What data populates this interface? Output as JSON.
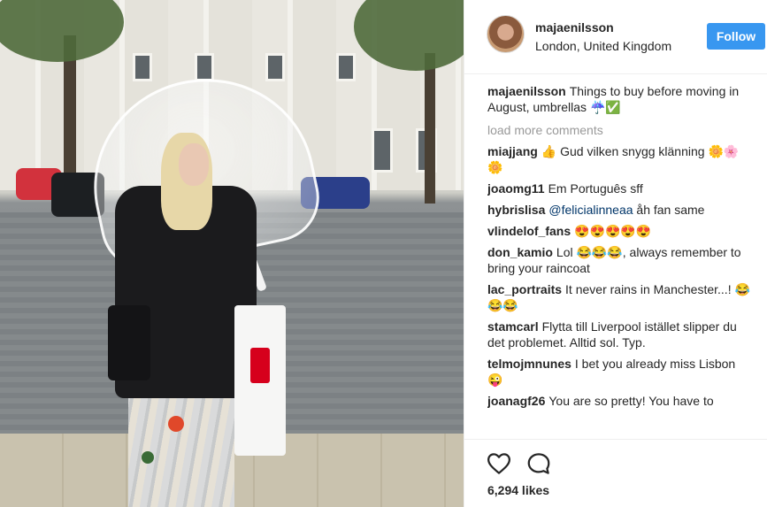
{
  "post": {
    "username": "majaenilsson",
    "location": "London, United Kingdom",
    "follow_label": "Follow",
    "caption_user": "majaenilsson",
    "caption_text": "Things to buy before moving in August, umbrellas ☔✅",
    "load_more": "load more comments",
    "likes": "6,294 likes"
  },
  "comments": [
    {
      "user": "miajjang",
      "text": "👍 Gud vilken snygg klänning 🌼🌸🌼"
    },
    {
      "user": "joaomg11",
      "text": "Em Português sff"
    },
    {
      "user": "hybrislisa",
      "mention": "@felicialinneaa",
      "text": "åh fan same"
    },
    {
      "user": "vlindelof_fans",
      "text": "😍😍😍😍😍"
    },
    {
      "user": "don_kamio",
      "text": "Lol 😂😂😂, always remember to bring your raincoat"
    },
    {
      "user": "lac_portraits",
      "text": "It never rains in Manchester...! 😂😂😂"
    },
    {
      "user": "stamcarl",
      "text": "Flytta till Liverpool istället slipper du det problemet. Alltid sol. Typ."
    },
    {
      "user": "telmojmnunes",
      "text": "I bet you already miss Lisbon 😜"
    },
    {
      "user": "joanagf26",
      "text": "You are so pretty! You have to"
    }
  ],
  "icons": {
    "like": "heart-icon",
    "comment": "speech-bubble-icon"
  },
  "colors": {
    "follow_button": "#3897f0",
    "text": "#262626",
    "muted": "#999999",
    "mention": "#003569"
  }
}
